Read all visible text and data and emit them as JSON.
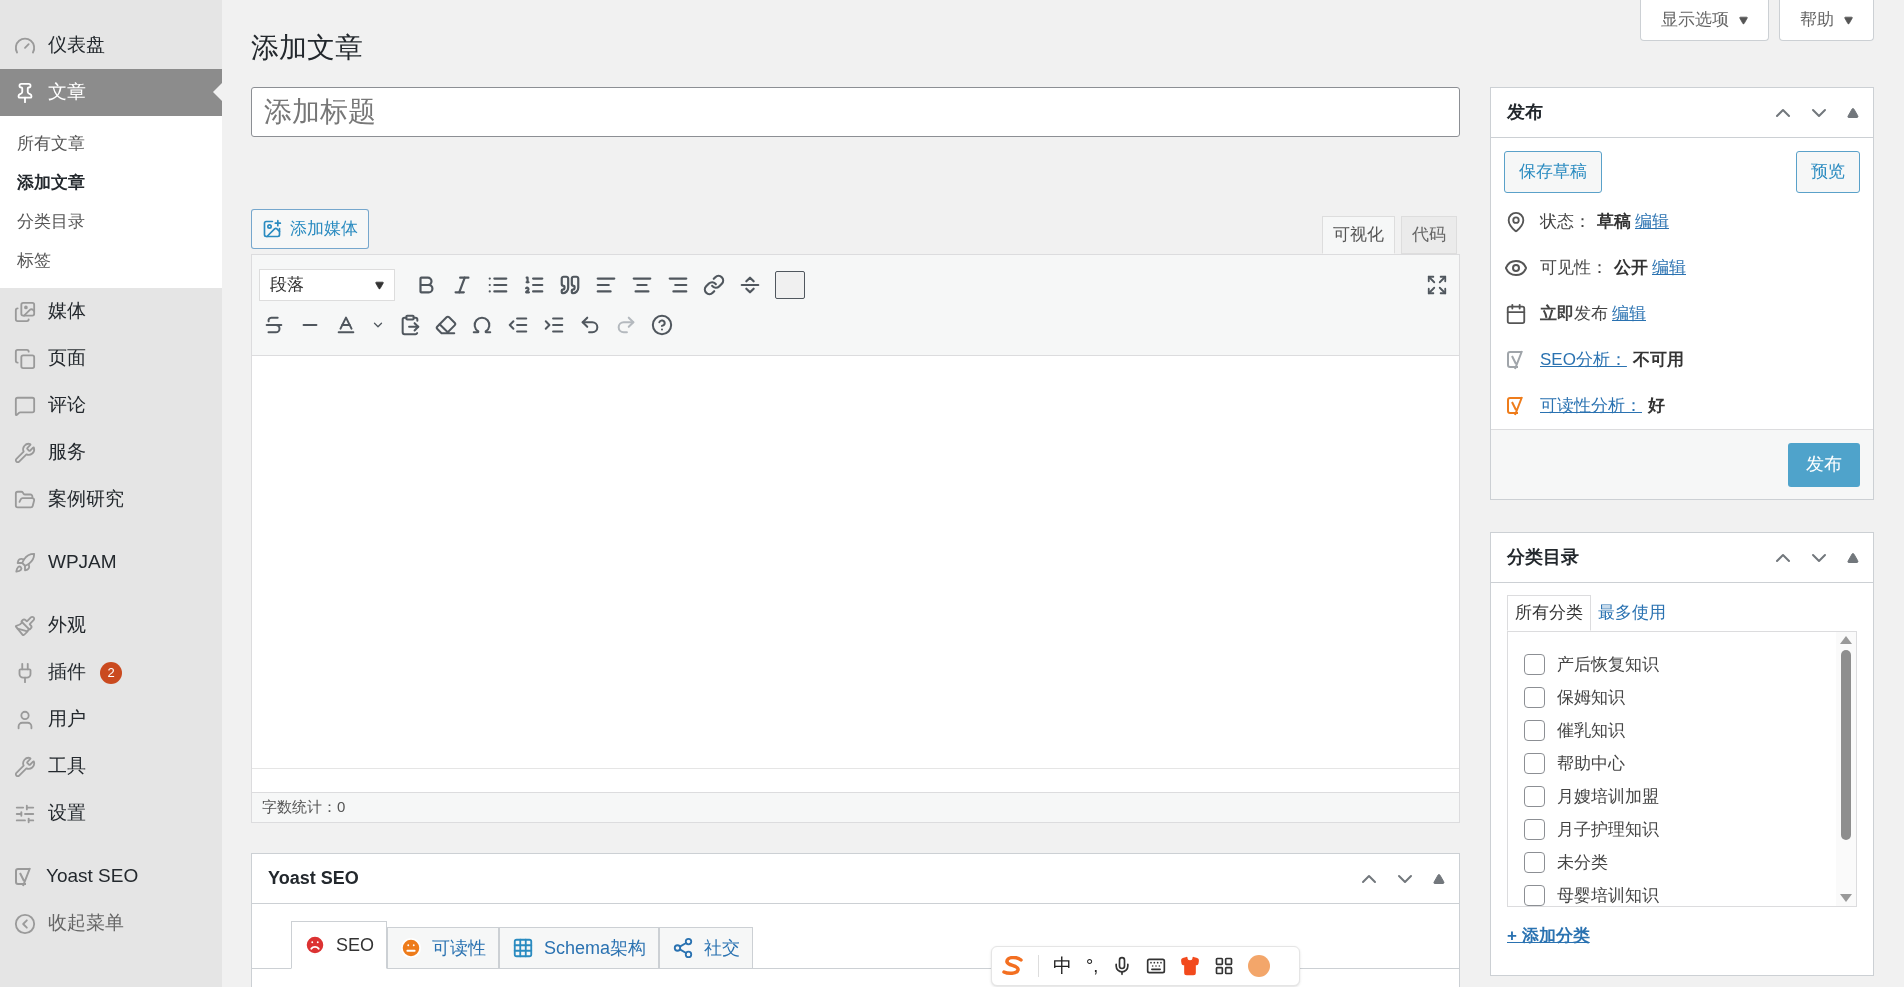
{
  "sidebar": {
    "items": [
      {
        "label": "仪表盘",
        "selected": false
      },
      {
        "label": "文章",
        "selected": true,
        "children": [
          {
            "label": "所有文章",
            "selected": false
          },
          {
            "label": "添加文章",
            "selected": true
          },
          {
            "label": "分类目录",
            "selected": false
          },
          {
            "label": "标签",
            "selected": false
          }
        ]
      },
      {
        "label": "媒体",
        "selected": false
      },
      {
        "label": "页面",
        "selected": false
      },
      {
        "label": "评论",
        "selected": false
      },
      {
        "label": "服务",
        "selected": false
      },
      {
        "label": "案例研究",
        "selected": false
      },
      {
        "label": "WPJAM",
        "selected": false
      },
      {
        "label": "外观",
        "selected": false
      },
      {
        "label": "插件",
        "selected": false,
        "badge": "2"
      },
      {
        "label": "用户",
        "selected": false
      },
      {
        "label": "工具",
        "selected": false
      },
      {
        "label": "设置",
        "selected": false
      },
      {
        "label": "Yoast SEO",
        "selected": false
      },
      {
        "label": "收起菜单",
        "selected": false
      }
    ]
  },
  "screen_buttons": [
    "显示选项",
    "帮助"
  ],
  "page_title": "添加文章",
  "title_field": {
    "placeholder": "添加标题"
  },
  "editor": {
    "add_media": "添加媒体",
    "tabs": [
      {
        "label": "可视化",
        "selected": true
      },
      {
        "label": "代码",
        "selected": false
      }
    ],
    "format_select": "段落",
    "word_count": "字数统计：0"
  },
  "publish": {
    "title": "发布",
    "save_draft": "保存草稿",
    "preview": "预览",
    "rows": [
      {
        "kind": "meta",
        "label": "状态：",
        "value": "草稿",
        "link": "编辑"
      },
      {
        "kind": "meta",
        "label": "可见性：",
        "value": "公开",
        "link": "编辑"
      },
      {
        "kind": "schedule",
        "text": "**立即**发布",
        "link": "编辑"
      },
      {
        "kind": "analysis",
        "link": "SEO分析：",
        "value": "不可用",
        "color": "#a0a5aa"
      },
      {
        "kind": "analysis",
        "link": "可读性分析：",
        "value": "好",
        "color": "#ee7c1b"
      }
    ],
    "publish_button": "发布"
  },
  "categories": {
    "title": "分类目录",
    "tabs": [
      {
        "label": "所有分类",
        "selected": true
      },
      {
        "label": "最多使用",
        "selected": false
      }
    ],
    "items": [
      {
        "label": "产后恢复知识",
        "checked": false
      },
      {
        "label": "保姆知识",
        "checked": false
      },
      {
        "label": "催乳知识",
        "checked": false
      },
      {
        "label": "帮助中心",
        "checked": false
      },
      {
        "label": "月嫂培训加盟",
        "checked": false
      },
      {
        "label": "月子护理知识",
        "checked": false
      },
      {
        "label": "未分类",
        "checked": false
      },
      {
        "label": "母婴培训知识",
        "checked": false
      }
    ],
    "add_link": "+ 添加分类"
  },
  "yoast": {
    "title": "Yoast SEO",
    "tabs": [
      {
        "label": "SEO",
        "kind": "sad",
        "selected": true
      },
      {
        "label": "可读性",
        "kind": "neutral",
        "selected": false
      },
      {
        "label": "Schema架构",
        "kind": "grid",
        "selected": false
      },
      {
        "label": "社交",
        "kind": "share",
        "selected": false
      }
    ]
  },
  "ime_bar": {
    "texts": [
      "中",
      "°,"
    ]
  }
}
